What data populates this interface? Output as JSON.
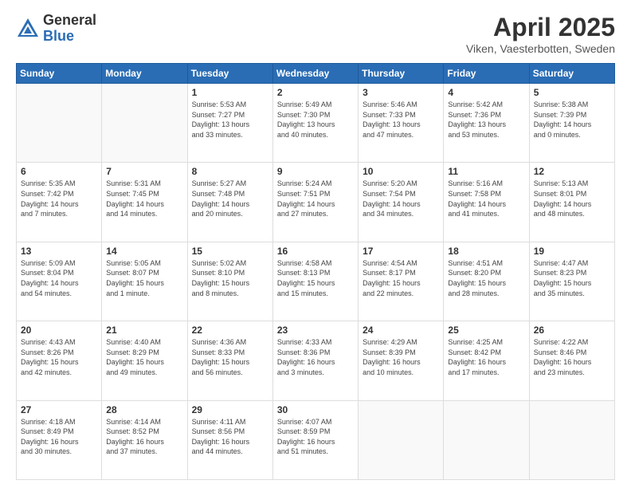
{
  "header": {
    "logo_general": "General",
    "logo_blue": "Blue",
    "title": "April 2025",
    "location": "Viken, Vaesterbotten, Sweden"
  },
  "calendar": {
    "days_of_week": [
      "Sunday",
      "Monday",
      "Tuesday",
      "Wednesday",
      "Thursday",
      "Friday",
      "Saturday"
    ],
    "weeks": [
      [
        {
          "day": "",
          "info": ""
        },
        {
          "day": "",
          "info": ""
        },
        {
          "day": "1",
          "info": "Sunrise: 5:53 AM\nSunset: 7:27 PM\nDaylight: 13 hours\nand 33 minutes."
        },
        {
          "day": "2",
          "info": "Sunrise: 5:49 AM\nSunset: 7:30 PM\nDaylight: 13 hours\nand 40 minutes."
        },
        {
          "day": "3",
          "info": "Sunrise: 5:46 AM\nSunset: 7:33 PM\nDaylight: 13 hours\nand 47 minutes."
        },
        {
          "day": "4",
          "info": "Sunrise: 5:42 AM\nSunset: 7:36 PM\nDaylight: 13 hours\nand 53 minutes."
        },
        {
          "day": "5",
          "info": "Sunrise: 5:38 AM\nSunset: 7:39 PM\nDaylight: 14 hours\nand 0 minutes."
        }
      ],
      [
        {
          "day": "6",
          "info": "Sunrise: 5:35 AM\nSunset: 7:42 PM\nDaylight: 14 hours\nand 7 minutes."
        },
        {
          "day": "7",
          "info": "Sunrise: 5:31 AM\nSunset: 7:45 PM\nDaylight: 14 hours\nand 14 minutes."
        },
        {
          "day": "8",
          "info": "Sunrise: 5:27 AM\nSunset: 7:48 PM\nDaylight: 14 hours\nand 20 minutes."
        },
        {
          "day": "9",
          "info": "Sunrise: 5:24 AM\nSunset: 7:51 PM\nDaylight: 14 hours\nand 27 minutes."
        },
        {
          "day": "10",
          "info": "Sunrise: 5:20 AM\nSunset: 7:54 PM\nDaylight: 14 hours\nand 34 minutes."
        },
        {
          "day": "11",
          "info": "Sunrise: 5:16 AM\nSunset: 7:58 PM\nDaylight: 14 hours\nand 41 minutes."
        },
        {
          "day": "12",
          "info": "Sunrise: 5:13 AM\nSunset: 8:01 PM\nDaylight: 14 hours\nand 48 minutes."
        }
      ],
      [
        {
          "day": "13",
          "info": "Sunrise: 5:09 AM\nSunset: 8:04 PM\nDaylight: 14 hours\nand 54 minutes."
        },
        {
          "day": "14",
          "info": "Sunrise: 5:05 AM\nSunset: 8:07 PM\nDaylight: 15 hours\nand 1 minute."
        },
        {
          "day": "15",
          "info": "Sunrise: 5:02 AM\nSunset: 8:10 PM\nDaylight: 15 hours\nand 8 minutes."
        },
        {
          "day": "16",
          "info": "Sunrise: 4:58 AM\nSunset: 8:13 PM\nDaylight: 15 hours\nand 15 minutes."
        },
        {
          "day": "17",
          "info": "Sunrise: 4:54 AM\nSunset: 8:17 PM\nDaylight: 15 hours\nand 22 minutes."
        },
        {
          "day": "18",
          "info": "Sunrise: 4:51 AM\nSunset: 8:20 PM\nDaylight: 15 hours\nand 28 minutes."
        },
        {
          "day": "19",
          "info": "Sunrise: 4:47 AM\nSunset: 8:23 PM\nDaylight: 15 hours\nand 35 minutes."
        }
      ],
      [
        {
          "day": "20",
          "info": "Sunrise: 4:43 AM\nSunset: 8:26 PM\nDaylight: 15 hours\nand 42 minutes."
        },
        {
          "day": "21",
          "info": "Sunrise: 4:40 AM\nSunset: 8:29 PM\nDaylight: 15 hours\nand 49 minutes."
        },
        {
          "day": "22",
          "info": "Sunrise: 4:36 AM\nSunset: 8:33 PM\nDaylight: 15 hours\nand 56 minutes."
        },
        {
          "day": "23",
          "info": "Sunrise: 4:33 AM\nSunset: 8:36 PM\nDaylight: 16 hours\nand 3 minutes."
        },
        {
          "day": "24",
          "info": "Sunrise: 4:29 AM\nSunset: 8:39 PM\nDaylight: 16 hours\nand 10 minutes."
        },
        {
          "day": "25",
          "info": "Sunrise: 4:25 AM\nSunset: 8:42 PM\nDaylight: 16 hours\nand 17 minutes."
        },
        {
          "day": "26",
          "info": "Sunrise: 4:22 AM\nSunset: 8:46 PM\nDaylight: 16 hours\nand 23 minutes."
        }
      ],
      [
        {
          "day": "27",
          "info": "Sunrise: 4:18 AM\nSunset: 8:49 PM\nDaylight: 16 hours\nand 30 minutes."
        },
        {
          "day": "28",
          "info": "Sunrise: 4:14 AM\nSunset: 8:52 PM\nDaylight: 16 hours\nand 37 minutes."
        },
        {
          "day": "29",
          "info": "Sunrise: 4:11 AM\nSunset: 8:56 PM\nDaylight: 16 hours\nand 44 minutes."
        },
        {
          "day": "30",
          "info": "Sunrise: 4:07 AM\nSunset: 8:59 PM\nDaylight: 16 hours\nand 51 minutes."
        },
        {
          "day": "",
          "info": ""
        },
        {
          "day": "",
          "info": ""
        },
        {
          "day": "",
          "info": ""
        }
      ]
    ]
  }
}
